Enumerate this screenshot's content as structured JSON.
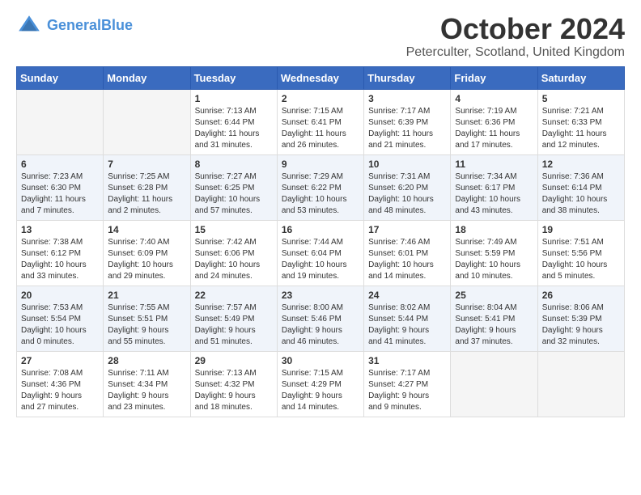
{
  "header": {
    "logo_line1": "General",
    "logo_line2": "Blue",
    "month_title": "October 2024",
    "location": "Peterculter, Scotland, United Kingdom"
  },
  "weekdays": [
    "Sunday",
    "Monday",
    "Tuesday",
    "Wednesday",
    "Thursday",
    "Friday",
    "Saturday"
  ],
  "weeks": [
    [
      {
        "day": "",
        "text": ""
      },
      {
        "day": "",
        "text": ""
      },
      {
        "day": "1",
        "text": "Sunrise: 7:13 AM\nSunset: 6:44 PM\nDaylight: 11 hours\nand 31 minutes."
      },
      {
        "day": "2",
        "text": "Sunrise: 7:15 AM\nSunset: 6:41 PM\nDaylight: 11 hours\nand 26 minutes."
      },
      {
        "day": "3",
        "text": "Sunrise: 7:17 AM\nSunset: 6:39 PM\nDaylight: 11 hours\nand 21 minutes."
      },
      {
        "day": "4",
        "text": "Sunrise: 7:19 AM\nSunset: 6:36 PM\nDaylight: 11 hours\nand 17 minutes."
      },
      {
        "day": "5",
        "text": "Sunrise: 7:21 AM\nSunset: 6:33 PM\nDaylight: 11 hours\nand 12 minutes."
      }
    ],
    [
      {
        "day": "6",
        "text": "Sunrise: 7:23 AM\nSunset: 6:30 PM\nDaylight: 11 hours\nand 7 minutes."
      },
      {
        "day": "7",
        "text": "Sunrise: 7:25 AM\nSunset: 6:28 PM\nDaylight: 11 hours\nand 2 minutes."
      },
      {
        "day": "8",
        "text": "Sunrise: 7:27 AM\nSunset: 6:25 PM\nDaylight: 10 hours\nand 57 minutes."
      },
      {
        "day": "9",
        "text": "Sunrise: 7:29 AM\nSunset: 6:22 PM\nDaylight: 10 hours\nand 53 minutes."
      },
      {
        "day": "10",
        "text": "Sunrise: 7:31 AM\nSunset: 6:20 PM\nDaylight: 10 hours\nand 48 minutes."
      },
      {
        "day": "11",
        "text": "Sunrise: 7:34 AM\nSunset: 6:17 PM\nDaylight: 10 hours\nand 43 minutes."
      },
      {
        "day": "12",
        "text": "Sunrise: 7:36 AM\nSunset: 6:14 PM\nDaylight: 10 hours\nand 38 minutes."
      }
    ],
    [
      {
        "day": "13",
        "text": "Sunrise: 7:38 AM\nSunset: 6:12 PM\nDaylight: 10 hours\nand 33 minutes."
      },
      {
        "day": "14",
        "text": "Sunrise: 7:40 AM\nSunset: 6:09 PM\nDaylight: 10 hours\nand 29 minutes."
      },
      {
        "day": "15",
        "text": "Sunrise: 7:42 AM\nSunset: 6:06 PM\nDaylight: 10 hours\nand 24 minutes."
      },
      {
        "day": "16",
        "text": "Sunrise: 7:44 AM\nSunset: 6:04 PM\nDaylight: 10 hours\nand 19 minutes."
      },
      {
        "day": "17",
        "text": "Sunrise: 7:46 AM\nSunset: 6:01 PM\nDaylight: 10 hours\nand 14 minutes."
      },
      {
        "day": "18",
        "text": "Sunrise: 7:49 AM\nSunset: 5:59 PM\nDaylight: 10 hours\nand 10 minutes."
      },
      {
        "day": "19",
        "text": "Sunrise: 7:51 AM\nSunset: 5:56 PM\nDaylight: 10 hours\nand 5 minutes."
      }
    ],
    [
      {
        "day": "20",
        "text": "Sunrise: 7:53 AM\nSunset: 5:54 PM\nDaylight: 10 hours\nand 0 minutes."
      },
      {
        "day": "21",
        "text": "Sunrise: 7:55 AM\nSunset: 5:51 PM\nDaylight: 9 hours\nand 55 minutes."
      },
      {
        "day": "22",
        "text": "Sunrise: 7:57 AM\nSunset: 5:49 PM\nDaylight: 9 hours\nand 51 minutes."
      },
      {
        "day": "23",
        "text": "Sunrise: 8:00 AM\nSunset: 5:46 PM\nDaylight: 9 hours\nand 46 minutes."
      },
      {
        "day": "24",
        "text": "Sunrise: 8:02 AM\nSunset: 5:44 PM\nDaylight: 9 hours\nand 41 minutes."
      },
      {
        "day": "25",
        "text": "Sunrise: 8:04 AM\nSunset: 5:41 PM\nDaylight: 9 hours\nand 37 minutes."
      },
      {
        "day": "26",
        "text": "Sunrise: 8:06 AM\nSunset: 5:39 PM\nDaylight: 9 hours\nand 32 minutes."
      }
    ],
    [
      {
        "day": "27",
        "text": "Sunrise: 7:08 AM\nSunset: 4:36 PM\nDaylight: 9 hours\nand 27 minutes."
      },
      {
        "day": "28",
        "text": "Sunrise: 7:11 AM\nSunset: 4:34 PM\nDaylight: 9 hours\nand 23 minutes."
      },
      {
        "day": "29",
        "text": "Sunrise: 7:13 AM\nSunset: 4:32 PM\nDaylight: 9 hours\nand 18 minutes."
      },
      {
        "day": "30",
        "text": "Sunrise: 7:15 AM\nSunset: 4:29 PM\nDaylight: 9 hours\nand 14 minutes."
      },
      {
        "day": "31",
        "text": "Sunrise: 7:17 AM\nSunset: 4:27 PM\nDaylight: 9 hours\nand 9 minutes."
      },
      {
        "day": "",
        "text": ""
      },
      {
        "day": "",
        "text": ""
      }
    ]
  ]
}
